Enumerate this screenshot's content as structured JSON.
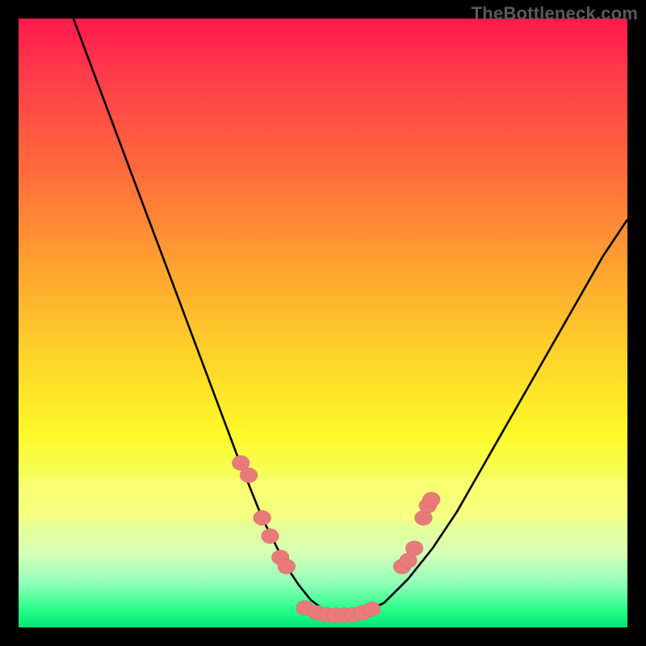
{
  "watermark": "TheBottleneck.com",
  "colors": {
    "frame_bg": "#000000",
    "dot": "#e87a7a",
    "curve": "#000000"
  },
  "chart_data": {
    "type": "line",
    "title": "",
    "xlabel": "",
    "ylabel": "",
    "xlim": [
      0,
      100
    ],
    "ylim": [
      0,
      100
    ],
    "grid": false,
    "legend": false,
    "series": [
      {
        "name": "curve",
        "x": [
          9,
          12,
          15,
          18,
          21,
          24,
          27,
          30,
          33,
          36,
          38,
          40,
          42,
          44,
          46,
          48,
          50,
          52,
          54,
          56,
          60,
          64,
          68,
          72,
          76,
          80,
          84,
          88,
          92,
          96,
          100
        ],
        "y": [
          100,
          92,
          84,
          76,
          68,
          60,
          52,
          44,
          36,
          28,
          23,
          18,
          14,
          10,
          7,
          4.5,
          3,
          2.2,
          2,
          2.2,
          4,
          8,
          13,
          19,
          26,
          33,
          40,
          47,
          54,
          61,
          67
        ]
      }
    ],
    "markers": {
      "left_branch": [
        {
          "x": 36.5,
          "y": 27
        },
        {
          "x": 37.8,
          "y": 25
        },
        {
          "x": 40.0,
          "y": 18
        },
        {
          "x": 41.3,
          "y": 15
        },
        {
          "x": 43.0,
          "y": 11.5
        },
        {
          "x": 44.0,
          "y": 10
        }
      ],
      "valley": [
        {
          "x": 47.0,
          "y": 3.2
        },
        {
          "x": 49.0,
          "y": 2.4
        },
        {
          "x": 50.5,
          "y": 2.1
        },
        {
          "x": 52.0,
          "y": 2.0
        },
        {
          "x": 53.5,
          "y": 2.0
        },
        {
          "x": 55.0,
          "y": 2.1
        },
        {
          "x": 56.5,
          "y": 2.4
        },
        {
          "x": 58.0,
          "y": 3.0
        }
      ],
      "right_branch": [
        {
          "x": 63.0,
          "y": 10
        },
        {
          "x": 64.0,
          "y": 11
        },
        {
          "x": 65.0,
          "y": 13
        },
        {
          "x": 66.5,
          "y": 18
        },
        {
          "x": 67.2,
          "y": 20
        },
        {
          "x": 67.8,
          "y": 21
        }
      ]
    }
  }
}
